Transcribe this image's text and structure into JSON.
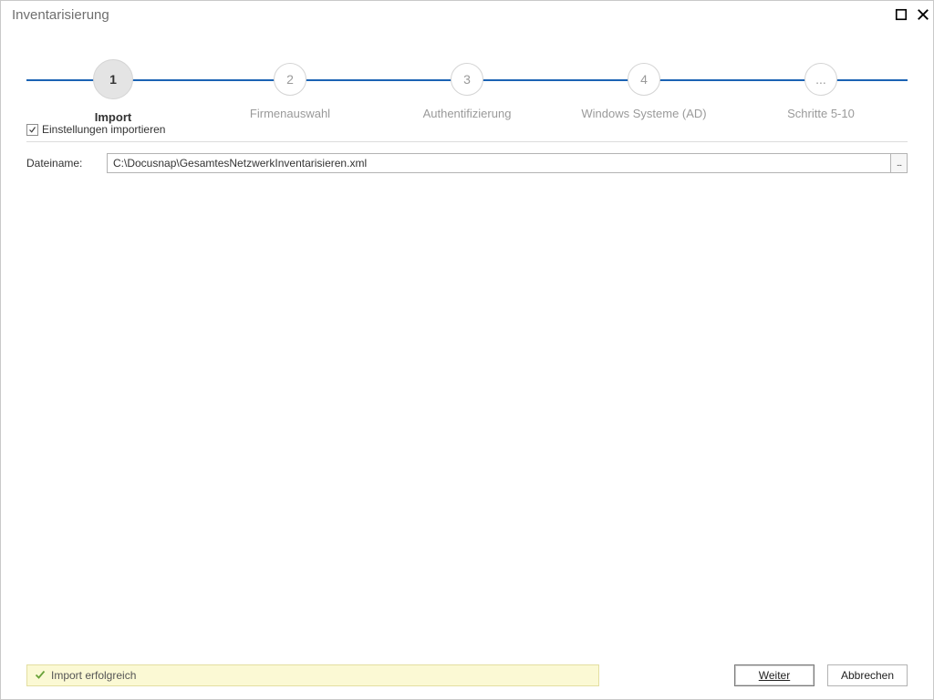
{
  "window": {
    "title": "Inventarisierung"
  },
  "stepper": {
    "steps": [
      {
        "num": "1",
        "label": "Import",
        "active": true
      },
      {
        "num": "2",
        "label": "Firmenauswahl",
        "active": false
      },
      {
        "num": "3",
        "label": "Authentifizierung",
        "active": false
      },
      {
        "num": "4",
        "label": "Windows Systeme (AD)",
        "active": false
      },
      {
        "num": "...",
        "label": "Schritte 5-10",
        "active": false
      }
    ]
  },
  "import_settings": {
    "checkbox_label": "Einstellungen importieren",
    "checked": true
  },
  "file": {
    "label": "Dateiname:",
    "value": "C:\\Docusnap\\GesamtesNetzwerkInventarisieren.xml",
    "browse_label": "..."
  },
  "status": {
    "text": "Import erfolgreich"
  },
  "buttons": {
    "next": "Weiter",
    "cancel": "Abbrechen"
  }
}
